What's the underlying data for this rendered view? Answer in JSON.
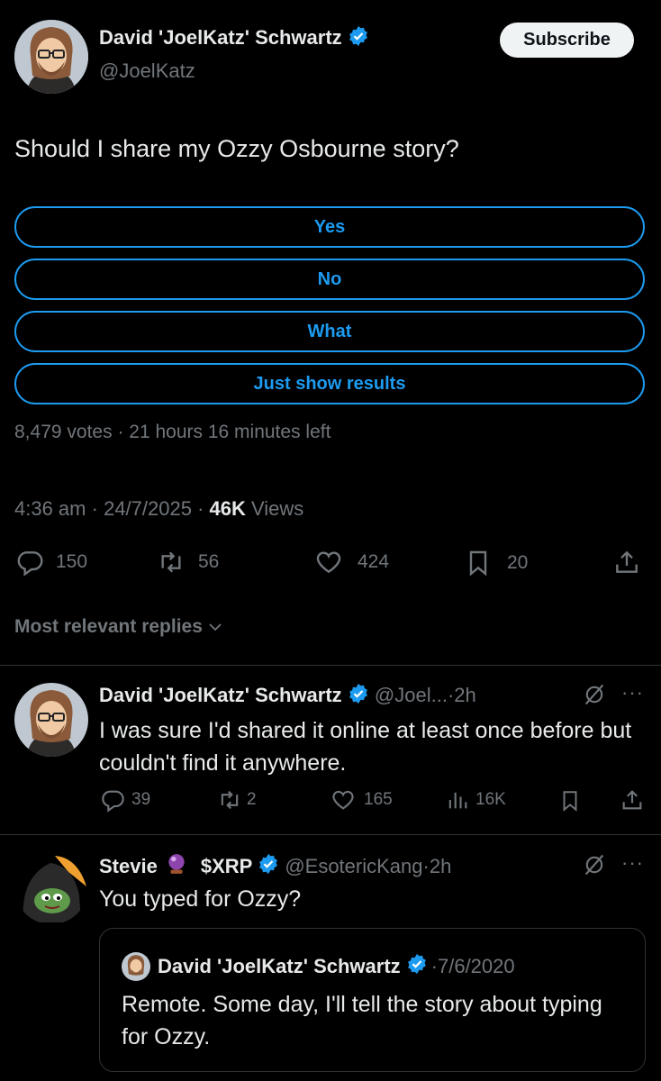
{
  "tweet": {
    "author_name": "David 'JoelKatz' Schwartz",
    "author_handle": "@JoelKatz",
    "subscribe_label": "Subscribe",
    "text": "Should I share my Ozzy Osbourne story?",
    "poll": {
      "options": [
        "Yes",
        "No",
        "What",
        "Just show results"
      ],
      "votes": "8,479 votes",
      "time_left": "21 hours 16 minutes left"
    },
    "time": "4:36 am",
    "date": "24/7/2025",
    "views_count": "46K",
    "views_label": "Views",
    "replies": "150",
    "retweets": "56",
    "likes": "424",
    "bookmarks": "20"
  },
  "replies_filter": "Most relevant replies",
  "reply1": {
    "author_name": "David 'JoelKatz' Schwartz",
    "handle": "@Joel...",
    "age": "2h",
    "text": "I was sure I'd shared it online at least once before but couldn't find it anywhere.",
    "replies": "39",
    "retweets": "2",
    "likes": "165",
    "views": "16K"
  },
  "reply2": {
    "author_name_a": "Stevie",
    "author_name_b": "$XRP",
    "handle": "@EsotericKang",
    "age": "2h",
    "text": "You typed for Ozzy?",
    "quote": {
      "author_name": "David 'JoelKatz' Schwartz",
      "date": "7/6/2020",
      "text": "Remote. Some day, I'll tell the story about typing for Ozzy."
    }
  },
  "colors": {
    "accent": "#1d9bf0",
    "muted": "#71767b",
    "text": "#e7e9ea",
    "background": "#000000"
  }
}
